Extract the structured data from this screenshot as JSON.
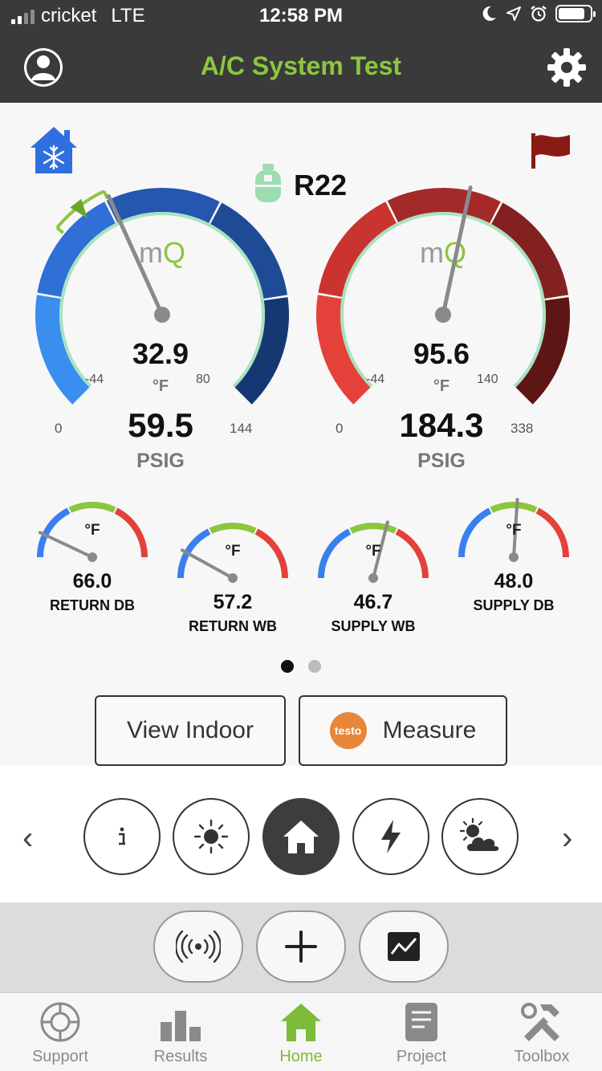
{
  "status_bar": {
    "carrier": "cricket",
    "network": "LTE",
    "time": "12:58 PM",
    "icons": [
      "moon-icon",
      "location-icon",
      "alarm-icon",
      "battery-icon"
    ]
  },
  "header": {
    "title": "A/C System Test",
    "title_color": "#8cc63f",
    "left_icon": "user-avatar-icon",
    "right_icon": "gear-icon"
  },
  "refrigerant": {
    "name": "R22",
    "icons": [
      "home-snowflake-icon",
      "refrigerant-tank-icon",
      "red-flag-icon"
    ]
  },
  "gauges": [
    {
      "side": "low",
      "brand_mark": "mQ",
      "temperature": "32.9",
      "temp_unit": "°F",
      "temp_min": "-44",
      "temp_max": "80",
      "pressure": "59.5",
      "pressure_unit": "PSIG",
      "pressure_min": "0",
      "pressure_max": "144",
      "needle_fraction": 0.41,
      "target_fraction": 0.36,
      "colors": [
        "#3a8ef0",
        "#2f6fd6",
        "#2556b0",
        "#1f4a96",
        "#163872"
      ]
    },
    {
      "side": "high",
      "brand_mark": "mQ",
      "temperature": "95.6",
      "temp_unit": "°F",
      "temp_min": "-44",
      "temp_max": "140",
      "pressure": "184.3",
      "pressure_unit": "PSIG",
      "pressure_min": "0",
      "pressure_max": "338",
      "needle_fraction": 0.545,
      "colors": [
        "#e3413a",
        "#c93330",
        "#a32a28",
        "#822120",
        "#5e1614"
      ]
    }
  ],
  "small_gauges": [
    {
      "value": "66.0",
      "unit": "°F",
      "label": "RETURN DB",
      "needle_fraction": 0.14
    },
    {
      "value": "57.2",
      "unit": "°F",
      "label": "RETURN WB",
      "needle_fraction": 0.16
    },
    {
      "value": "46.7",
      "unit": "°F",
      "label": "SUPPLY WB",
      "needle_fraction": 0.58
    },
    {
      "value": "48.0",
      "unit": "°F",
      "label": "SUPPLY DB",
      "needle_fraction": 0.52
    }
  ],
  "pager": {
    "pages": 2,
    "current": 1
  },
  "buttons": {
    "view_indoor": "View Indoor",
    "measure": "Measure",
    "testo_logo": "testo"
  },
  "categories": {
    "items": [
      "info-icon",
      "sun-icon",
      "home-icon",
      "lightning-icon",
      "partly-cloudy-icon"
    ],
    "active": "home-icon",
    "prev": "‹",
    "next": "›"
  },
  "tools": [
    "wireless-signal-icon",
    "plus-icon",
    "chart-icon"
  ],
  "tabbar": {
    "items": [
      {
        "label": "Support",
        "icon": "lifebuoy-icon"
      },
      {
        "label": "Results",
        "icon": "bar-chart-icon"
      },
      {
        "label": "Home",
        "icon": "home-icon"
      },
      {
        "label": "Project",
        "icon": "document-icon"
      },
      {
        "label": "Toolbox",
        "icon": "tools-icon"
      }
    ],
    "active": "Home",
    "active_color": "#7dbb3b"
  }
}
